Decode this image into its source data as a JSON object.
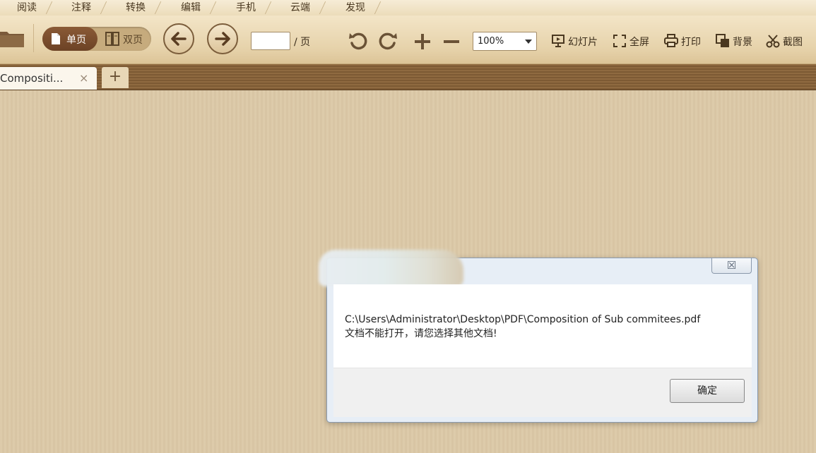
{
  "menu": {
    "tabs": [
      {
        "label": "阅读"
      },
      {
        "label": "注释"
      },
      {
        "label": "转换"
      },
      {
        "label": "编辑"
      },
      {
        "label": "手机"
      },
      {
        "label": "云端"
      },
      {
        "label": "发现"
      }
    ]
  },
  "toolbar": {
    "single_page_label": "单页",
    "double_page_label": "双页",
    "page_input_value": "",
    "page_suffix": "/ 页",
    "zoom_value": "100%",
    "slideshow_label": "幻灯片",
    "fullscreen_label": "全屏",
    "print_label": "打印",
    "background_label": "背景",
    "screenshot_label": "截图"
  },
  "doc_tabs": {
    "active_label": "Compositi...",
    "close_glyph": "×",
    "add_glyph": "+"
  },
  "dialog": {
    "close_glyph": "☒",
    "message_path": "C:\\Users\\Administrator\\Desktop\\PDF\\Composition of Sub commitees.pdf",
    "message_text": "文档不能打开，请您选择其他文档!",
    "ok_label": "确定"
  },
  "colors": {
    "toolbar": "#e6d2aa",
    "tab_bar": "#8f6a40",
    "workspace": "#dcc9a7",
    "active_view": "#6c4225"
  }
}
